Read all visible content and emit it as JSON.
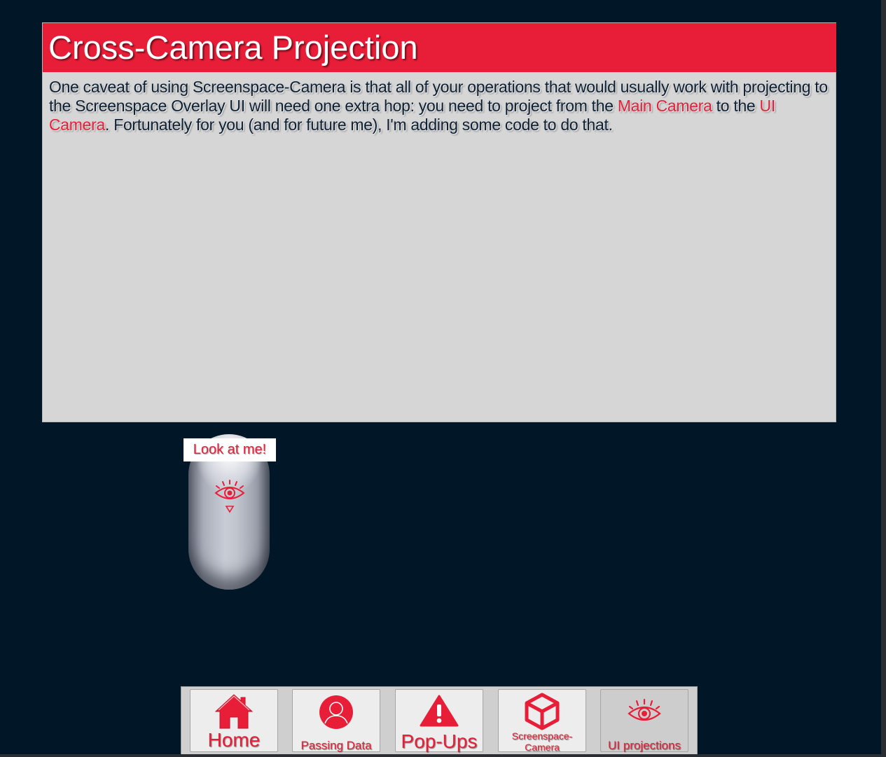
{
  "panel": {
    "title": "Cross-Camera Projection",
    "body_parts": {
      "p1": "One caveat of using Screenspace-Camera is that all of your operations that would usually work with projecting to the Screenspace Overlay UI will need one extra hop: you need to project from the ",
      "link1": "Main Camera",
      "p2": " to the ",
      "link2": "UI Camera",
      "p3": ". Fortunately for you (and for future me), I'm adding some code to do that."
    }
  },
  "scene": {
    "label": "Look at me!",
    "capsule_icon": "eye-icon"
  },
  "nav": {
    "items": [
      {
        "label": "Home",
        "icon": "home-icon",
        "active": false
      },
      {
        "label": "Passing Data",
        "icon": "user-icon",
        "active": false
      },
      {
        "label": "Pop-Ups",
        "icon": "warning-icon",
        "active": false
      },
      {
        "label": "Screenspace-\nCamera",
        "icon": "cube-icon",
        "active": false
      },
      {
        "label": "UI projections",
        "icon": "eye-icon",
        "active": true
      }
    ]
  },
  "colors": {
    "accent": "#e81e38",
    "background": "#011627",
    "panel": "#d6d6d6"
  }
}
